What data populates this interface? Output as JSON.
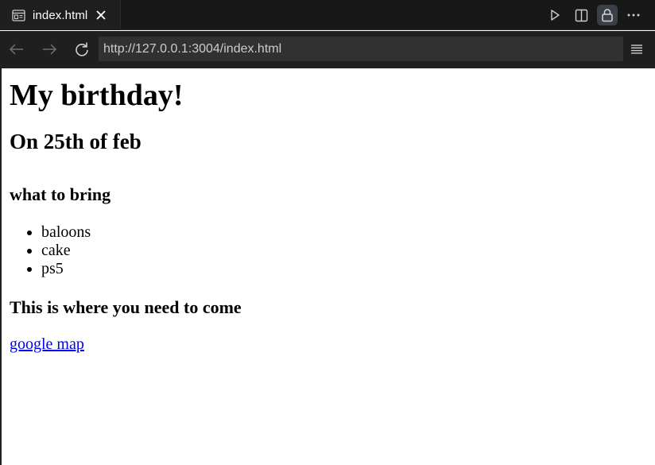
{
  "tab": {
    "title": "index.html",
    "icon": "preview-icon",
    "close_icon": "close-icon"
  },
  "toolbar_actions": [
    {
      "name": "run-icon"
    },
    {
      "name": "split-editor-icon"
    },
    {
      "name": "lock-icon",
      "active": true
    },
    {
      "name": "more-icon"
    }
  ],
  "navigation": {
    "back_icon": "arrow-left-icon",
    "forward_icon": "arrow-right-icon",
    "reload_icon": "reload-icon",
    "url": "http://127.0.0.1:3004/index.html",
    "menu_icon": "hamburger-icon"
  },
  "page": {
    "heading": "My birthday!",
    "subheading": "On 25th of feb",
    "bring_heading": "what to bring",
    "bring_items": [
      "baloons",
      "cake",
      "ps5"
    ],
    "location_heading": "This is where you need to come",
    "map_link": "google map"
  },
  "colors": {
    "chrome_bg": "#181818",
    "nav_bg": "#1f1f1f",
    "url_bg": "#313131",
    "link": "#0000ee"
  }
}
